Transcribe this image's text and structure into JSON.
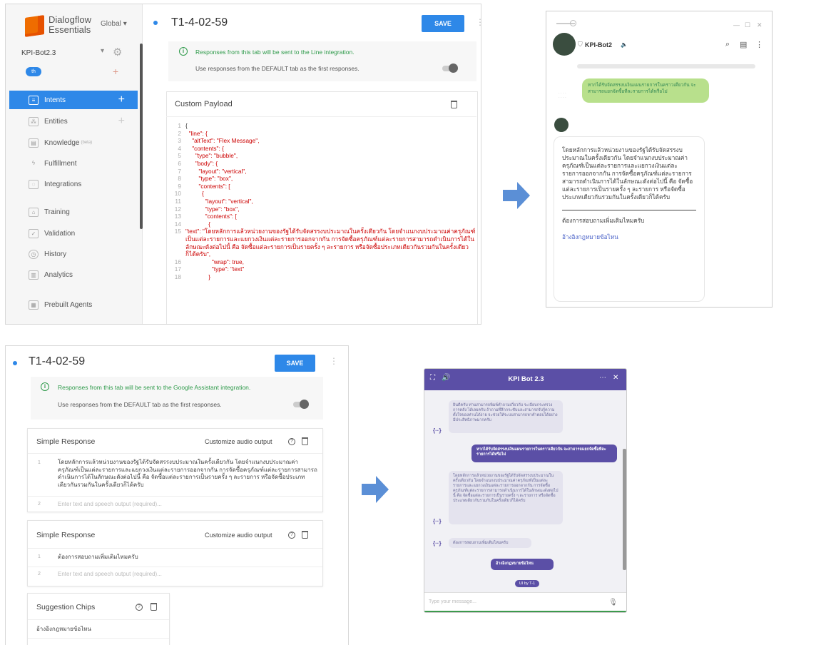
{
  "dialogflow_line": {
    "brand_line1": "Dialogflow",
    "brand_line2": "Essentials",
    "region": "Global",
    "agent_name": "KPI-Bot2.3",
    "language": "th",
    "nav": [
      {
        "label": "Intents",
        "icon": "chat-icon"
      },
      {
        "label": "Entities",
        "icon": "entities-icon"
      },
      {
        "label": "Knowledge",
        "badge": "(beta)",
        "icon": "book-icon"
      },
      {
        "label": "Fulfillment",
        "icon": "bolt-icon"
      },
      {
        "label": "Integrations",
        "icon": "integrations-icon"
      },
      {
        "label": "Training",
        "icon": "training-icon"
      },
      {
        "label": "Validation",
        "icon": "validation-icon"
      },
      {
        "label": "History",
        "icon": "history-icon"
      },
      {
        "label": "Analytics",
        "icon": "analytics-icon"
      },
      {
        "label": "Prebuilt Agents",
        "icon": "prebuilt-icon"
      }
    ],
    "intent_title": "T1-4-02-59",
    "save_label": "SAVE",
    "info_text": "Responses from this tab will be sent to the Line integration.",
    "use_default": "Use responses from the DEFAULT tab as the first responses.",
    "payload_title": "Custom Payload",
    "code_lines": [
      {
        "n": "1",
        "t": "{"
      },
      {
        "n": "2",
        "t": "  \"line\": {"
      },
      {
        "n": "3",
        "t": "    \"altText\": \"Flex Message\","
      },
      {
        "n": "4",
        "t": "    \"contents\": {"
      },
      {
        "n": "5",
        "t": "      \"type\": \"bubble\","
      },
      {
        "n": "6",
        "t": "      \"body\": {"
      },
      {
        "n": "7",
        "t": "        \"layout\": \"vertical\","
      },
      {
        "n": "8",
        "t": "        \"type\": \"box\","
      },
      {
        "n": "9",
        "t": "        \"contents\": ["
      },
      {
        "n": "10",
        "t": "          {"
      },
      {
        "n": "11",
        "t": "            \"layout\": \"vertical\","
      },
      {
        "n": "12",
        "t": "            \"type\": \"box\","
      },
      {
        "n": "13",
        "t": "            \"contents\": ["
      },
      {
        "n": "14",
        "t": "              {"
      },
      {
        "n": "15",
        "t": "                \"text\": \"โดยหลักการแล้วหน่วยงานของรัฐได้รับจัดสรรงบประมาณในครั้งเดียวกัน โดยจำแนกงบประมาณค่าครุภัณฑ์เป็นแต่ละรายการและแยกวงเงินแต่ละรายการออกจากกัน การจัดซื้อครุภัณฑ์แต่ละรายการสามารถดำเนินการได้ในลักษณะดังต่อไปนี้ คือ จัดซื้อแต่ละรายการเป็นรายครั้ง ๆ ละรายการ หรือจัดซื้อประเภทเดียวกันรวมกันในครั้งเดียวก็ได้ครับ\","
      },
      {
        "n": "16",
        "t": "                \"wrap\": true,"
      },
      {
        "n": "17",
        "t": "                \"type\": \"text\""
      },
      {
        "n": "18",
        "t": "              }"
      }
    ]
  },
  "line_app": {
    "bot_name": "KPI-Bot2",
    "user_message": "หากได้รับจัดสรรงบเงินแผนรายการในคราวเดียวกัน จะสามารถแยกจัดซื้อทีละรายการได้หรือไม่",
    "bot_answer": "โดยหลักการแล้วหน่วยงานของรัฐได้รับจัดสรรงบประมาณในครั้งเดียวกัน โดยจำแนกงบประมาณค่าครุภัณฑ์เป็นแต่ละรายการและแยกวงเงินแต่ละรายการออกจากกัน การจัดซื้อครุภัณฑ์แต่ละรายการสามารถดำเนินการได้ในลักษณะดังต่อไปนี้ คือ จัดซื้อแต่ละรายการเป็นรายครั้ง ๆ ละรายการ หรือจัดซื้อประเภทเดียวกันรวมกันในครั้งเดียวก็ได้ครับ",
    "followup": "ต้องการสอบถามเพิ่มเติมไหมครับ",
    "link_text": "อ้างอิงกฎหมายข้อไหน"
  },
  "dialogflow_ga": {
    "intent_title": "T1-4-02-59",
    "save_label": "SAVE",
    "info_text": "Responses from this tab will be sent to the Google Assistant integration.",
    "use_default": "Use responses from the DEFAULT tab as the first responses.",
    "simple_response_title": "Simple Response",
    "customize_audio": "Customize audio output",
    "response1_text": "โดยหลักการแล้วหน่วยงานของรัฐได้รับจัดสรรงบประมาณในครั้งเดียวกัน โดยจำแนกงบประมาณค่าครุภัณฑ์เป็นแต่ละรายการและแยกวงเงินแต่ละรายการออกจากกัน การจัดซื้อครุภัณฑ์แต่ละรายการสามารถดำเนินการได้ในลักษณะดังต่อไปนี้ คือ จัดซื้อแต่ละรายการเป็นรายครั้ง ๆ ละรายการ หรือจัดซื้อประเภทเดียวกันรวมกันในครั้งเดียวก็ได้ครับ",
    "placeholder": "Enter text and speech output (required)...",
    "response2_text": "ต้องการสอบถามเพิ่มเติมไหมครับ",
    "chips_title": "Suggestion Chips",
    "chip_text": "อ้างอิงกฎหมายข้อไหน",
    "row1": "1",
    "row2": "2"
  },
  "kpi_widget": {
    "title": "KPI Bot 2.3",
    "greet": "ยินดีครับ ท่านสามารถพิมพ์คำถามเกี่ยวกับ ระเบียบกระทรวงการคลัง ได้เลยครับ ถ้าถามที่ลึกกระชับและสามารถรับรู้ความตั้งใจของท่านได้ง่าย จะช่วยให้ระบบสามารถหาคำตอบได้อย่างมีประสิทธิภาพมากครับ",
    "user_q": "หากได้รับจัดสรรงบเงินแผนรายการในคราวเดียวกัน จะสามารถแยกจัดซื้อทีละรายการได้หรือไม่",
    "answer": "โดยหลักการแล้วหน่วยงานของรัฐได้รับจัดสรรงบประมาณในครั้งเดียวกัน โดยจำแนกงบประมาณค่าครุภัณฑ์เป็นแต่ละรายการและแยกวงเงินแต่ละรายการออกจากกัน การจัดซื้อครุภัณฑ์แต่ละรายการสามารถดำเนินการได้ในลักษณะดังต่อไปนี้ คือ จัดซื้อแต่ละรายการเป็นรายครั้ง ๆ ละรายการ หรือจัดซื้อประเภทเดียวกันรวมกันในครั้งเดียวก็ได้ครับ",
    "followup": "ต้องการสอบถามเพิ่มเติมไหมครับ",
    "chip": "อ้างอิงกฎหมายข้อไหน",
    "badge": "UI by T-1",
    "input_placeholder": "Type your message..."
  },
  "colors": {
    "dialogflow_blue": "#2e88e8",
    "line_green": "#b8e08c",
    "kpi_purple": "#5b4fa6",
    "arrow_blue": "#5b8fd6"
  }
}
